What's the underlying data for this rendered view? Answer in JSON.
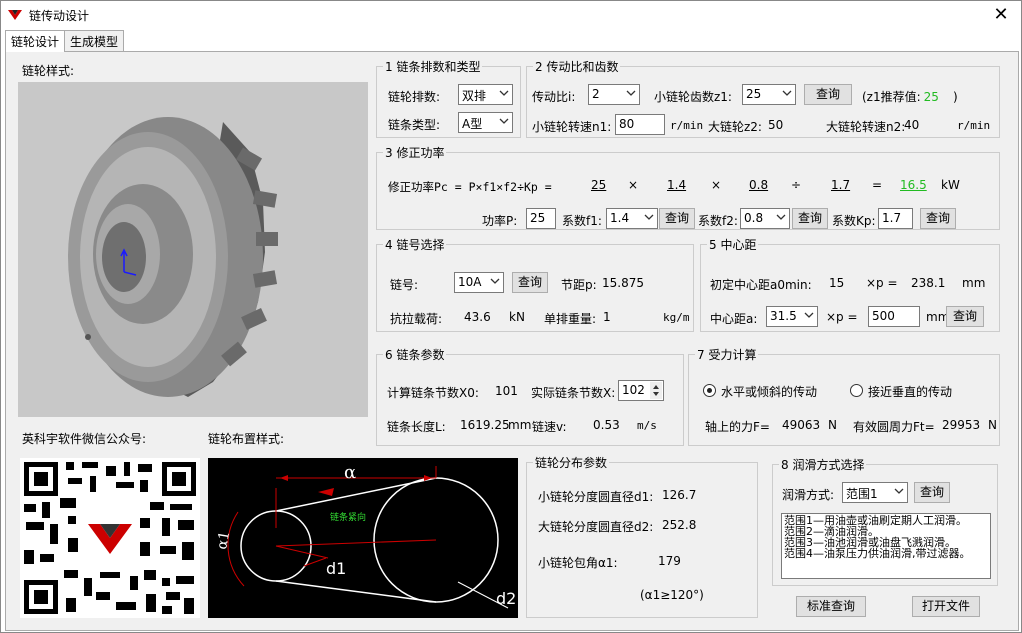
{
  "window": {
    "title": "链传动设计",
    "close": "✕"
  },
  "tabs": [
    "链轮设计",
    "生成模型"
  ],
  "left": {
    "style_label": "链轮样式:",
    "wechat_label": "英科宇软件微信公众号:",
    "layout_label": "链轮布置样式:",
    "diagram": {
      "a": "α",
      "a1": "α1",
      "d1": "d1",
      "d2": "d2",
      "tight": "链条紧向"
    }
  },
  "g1": {
    "legend": "1  链条排数和类型",
    "rows_label": "链轮排数:",
    "rows_value": "双排",
    "type_label": "链条类型:",
    "type_value": "A型"
  },
  "g2": {
    "legend": "2  传动比和齿数",
    "ratio_label": "传动比i:",
    "ratio_value": "2",
    "z1_label": "小链轮齿数z1:",
    "z1_value": "25",
    "query": "查询",
    "rec_prefix": "(z1推荐值:",
    "rec_value": "25",
    "rec_suffix": ")",
    "n1_label": "小链轮转速n1:",
    "n1_value": "80",
    "n1_unit": "r/min",
    "z2_label": "大链轮z2:",
    "z2_value": "50",
    "n2_label": "大链轮转速n2:",
    "n2_value": "40",
    "n2_unit": "r/min"
  },
  "g3": {
    "legend": "3  修正功率",
    "formula": "修正功率Pc = P×f1×f2÷Kp =",
    "p": "25",
    "times1": "×",
    "f1": "1.4",
    "times2": "×",
    "f2": "0.8",
    "div": "÷",
    "kp": "1.7",
    "eq": "=",
    "pc": "16.5",
    "unit": "kW",
    "p_label": "功率P:",
    "p_input": "25",
    "f1_label": "系数f1:",
    "f1_select": "1.4",
    "query1": "查询",
    "f2_label": "系数f2:",
    "f2_select": "0.8",
    "query2": "查询",
    "kp_label": "系数Kp:",
    "kp_input": "1.7",
    "query3": "查询"
  },
  "g4": {
    "legend": "4  链号选择",
    "chain_label": "链号:",
    "chain_value": "10A",
    "query": "查询",
    "pitch_label": "节距p:",
    "pitch_value": "15.875",
    "tensile_label": "抗拉载荷:",
    "tensile_value": "43.6",
    "tensile_unit": "kN",
    "weight_label": "单排重量:",
    "weight_value": "1",
    "weight_unit": "kg/m"
  },
  "g5": {
    "legend": "5  中心距",
    "a0_label": "初定中心距a0min:",
    "a0_mult": "15",
    "a0_xp": "×p =",
    "a0_value": "238.1",
    "a0_unit": "mm",
    "a_label": "中心距a:",
    "a_select": "31.5",
    "a_xp": "×p =",
    "a_input": "500",
    "a_unit": "mm",
    "query": "查询"
  },
  "g6": {
    "legend": "6  链条参数",
    "x0_label": "计算链条节数X0:",
    "x0_value": "101",
    "x_label": "实际链条节数X:",
    "x_value": "102",
    "len_label": "链条长度L:",
    "len_value": "1619.25",
    "len_unit": "mm",
    "v_label": "链速v:",
    "v_value": "0.53",
    "v_unit": "m/s"
  },
  "g7": {
    "legend": "7  受力计算",
    "opt1": "水平或倾斜的传动",
    "opt2": "接近垂直的传动",
    "f_label": "轴上的力F=",
    "f_value": "49063",
    "f_unit": "N",
    "ft_label": "有效圆周力Ft=",
    "ft_value": "29953",
    "ft_unit": "N"
  },
  "gd": {
    "legend": "链轮分布参数",
    "d1_label": "小链轮分度圆直径d1:",
    "d1_value": "126.7",
    "d2_label": "大链轮分度圆直径d2:",
    "d2_value": "252.8",
    "a1_label": "小链轮包角α1:",
    "a1_value": "179",
    "cond": "(α1≥120°)"
  },
  "g8": {
    "legend": "8  润滑方式选择",
    "lub_label": "润滑方式:",
    "lub_value": "范围1",
    "query": "查询",
    "lines": [
      "范围1—用油壶或油刷定期人工润滑。",
      "范围2—滴油润滑。",
      "范围3—油池润滑或油盘飞溅润滑。",
      "范围4—油泵压力供油润滑,带过滤器。"
    ]
  },
  "buttons": {
    "standard": "标准查询",
    "open": "打开文件"
  }
}
